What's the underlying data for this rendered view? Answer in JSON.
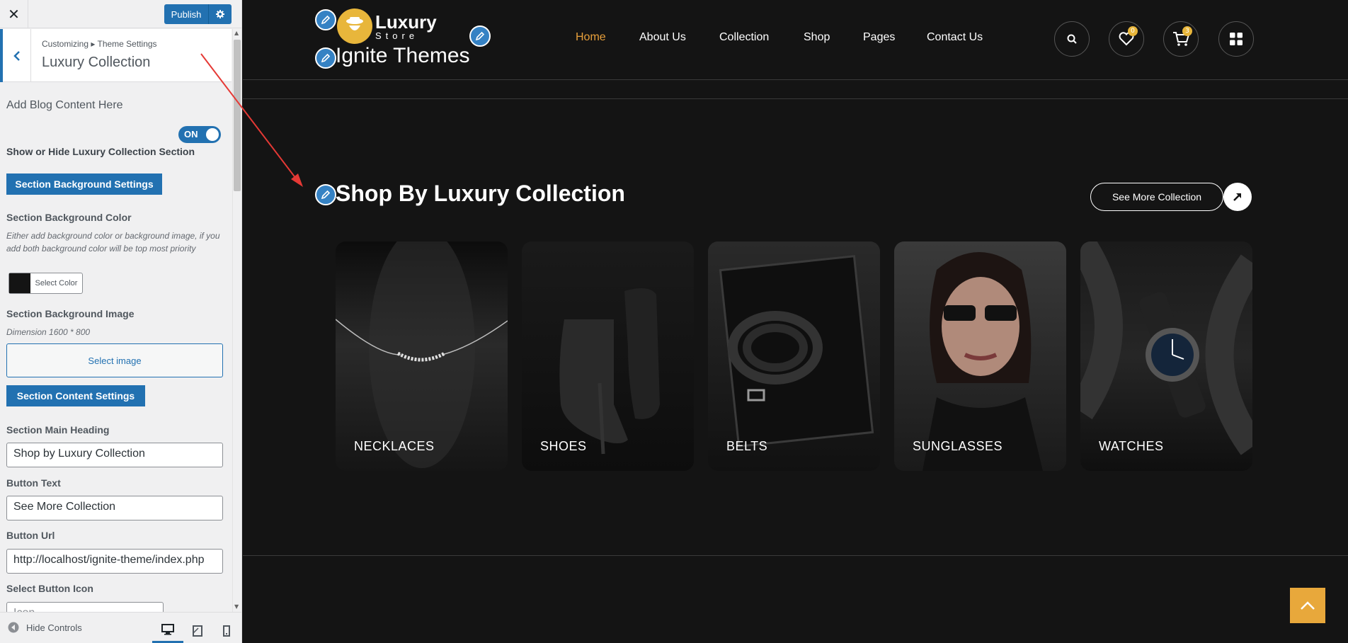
{
  "customizer": {
    "publish_label": "Publish",
    "breadcrumb": "Customizing ▸ Theme Settings",
    "panel_title": "Luxury Collection",
    "blog_label": "Add Blog Content Here",
    "toggle_label": "ON",
    "show_hide_label": "Show or Hide Luxury Collection Section",
    "bg_settings_button": "Section Background Settings",
    "bg_color_label": "Section Background Color",
    "bg_color_desc": "Either add background color or background image, if you add both background color will be top most priority",
    "select_color_label": "Select Color",
    "bg_color_value": "#141414",
    "bg_image_label": "Section Background Image",
    "bg_image_desc": "Dimension 1600 * 800",
    "select_image_label": "Select image",
    "content_settings_button": "Section Content Settings",
    "main_heading_label": "Section Main Heading",
    "main_heading_value": "Shop by Luxury Collection",
    "button_text_label": "Button Text",
    "button_text_value": "See More Collection",
    "button_url_label": "Button Url",
    "button_url_value": "http://localhost/ignite-theme/index.php",
    "button_icon_label": "Select Button Icon",
    "button_icon_value": "Icon",
    "hide_controls_label": "Hide Controls",
    "accent_color": "#2271b1"
  },
  "site": {
    "logo_main": "Luxury",
    "logo_sub": "Store",
    "site_title": "Ignite Themes",
    "nav": [
      "Home",
      "About Us",
      "Collection",
      "Shop",
      "Pages",
      "Contact Us"
    ],
    "wishlist_count": "0",
    "cart_count": "3",
    "accent_color": "#e8a03b",
    "icons": [
      "search-icon",
      "heart-icon",
      "cart-icon",
      "grid-icon"
    ]
  },
  "section": {
    "heading": "Shop By Luxury Collection",
    "see_more": "See More Collection",
    "categories": [
      "NECKLACES",
      "SHOES",
      "BELTS",
      "SUNGLASSES",
      "WATCHES"
    ]
  }
}
